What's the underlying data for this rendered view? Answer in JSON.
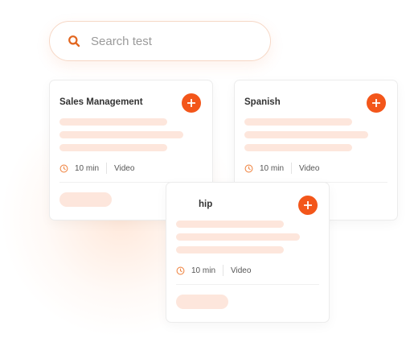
{
  "search": {
    "placeholder": "Search test",
    "icon": "search-icon"
  },
  "cards": [
    {
      "title": "Sales Management",
      "duration": "10 min",
      "type": "Video",
      "add_icon": "plus-icon"
    },
    {
      "title": "Spanish",
      "duration": "10 min",
      "type": "Video",
      "add_icon": "plus-icon"
    },
    {
      "title": "hip",
      "duration": "10 min",
      "type": "Video",
      "add_icon": "plus-icon"
    }
  ],
  "colors": {
    "accent": "#f3561a",
    "placeholder_bar": "#fde6dc",
    "search_border": "#f6d8c6"
  }
}
